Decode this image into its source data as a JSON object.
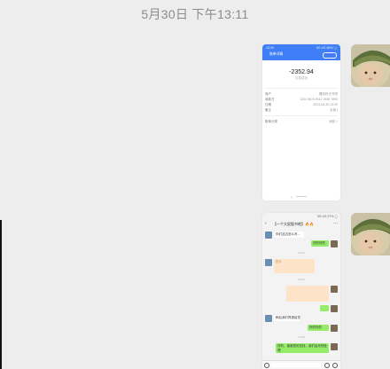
{
  "timestamp": "5月30日 下午13:11",
  "colors": {
    "background": "#ededed",
    "wechat_green": "#95ec69",
    "alipay_blue": "#3f7ef7"
  },
  "message_1": {
    "type": "image-screenshot",
    "status_bar": {
      "time": "13:29",
      "right": "5G 4G 56% ▢"
    },
    "nav_title": "账单详情",
    "amount": "-2352.94",
    "amount_status": "交易成功",
    "details": [
      {
        "label": "商户",
        "value": "雕刻时光书吧"
      },
      {
        "label": "收款方",
        "value": "1234 5678 9012 3456 7890"
      },
      {
        "label": "日期",
        "value": "2024-05-30 13:29"
      },
      {
        "label": "备注",
        "value": "全部  |"
      }
    ],
    "extra_row": {
      "label": "账单分类",
      "value": "消费 >"
    },
    "back_glyph": "‹"
  },
  "message_2": {
    "type": "image-screenshot",
    "status_bar": {
      "time": "13:29",
      "right": "5G 4G 57% ▢"
    },
    "chat_title": "【一个大屁股书吧】🔥🔥",
    "back_glyph": "‹",
    "more_glyph": "···",
    "bubbles": [
      {
        "side": "left",
        "text": "你们这边怎么写..."
      },
      {
        "side": "right",
        "text": "好的好的"
      },
      {
        "side": "left",
        "text": "图片"
      },
      {
        "side": "right",
        "text": ""
      },
      {
        "side": "left",
        "text": "稍后我们再退给您"
      },
      {
        "side": "right",
        "text": "好的好的"
      },
      {
        "side": "right",
        "text": "好的，谢谢您的支持，我们会尽快处理"
      }
    ],
    "times": [
      "13:22",
      "13:23",
      "13:25"
    ]
  }
}
